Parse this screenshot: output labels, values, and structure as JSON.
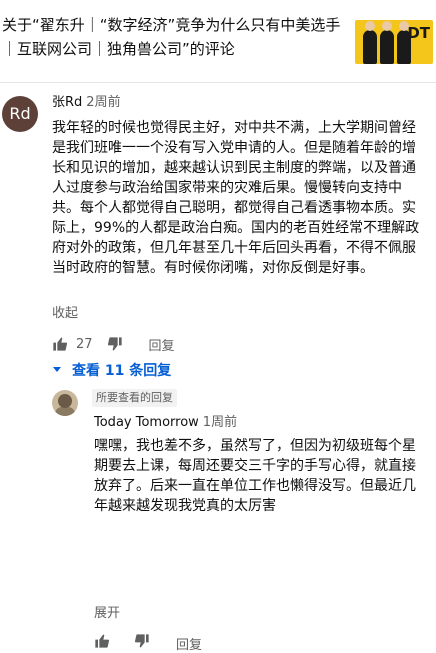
{
  "video": {
    "title": "关于“翟东升｜“数字经济”竞争为什么只有中美选手｜互联网公司｜独角兽公司”的评论",
    "thumbnail_logo": "DT"
  },
  "comment": {
    "avatar_initials": "Rd",
    "author": "张Rd",
    "time": "2周前",
    "text": "我年轻的时候也觉得民主好，对中共不满，上大学期间曾经是我们班唯一一个没有写入党申请的人。但是随着年龄的增长和见识的增加，越来越认识到民主制度的弊端，以及普通人过度参与政治给国家带来的灾难后果。慢慢转向支持中共。每个人都觉得自己聪明，都觉得自己看透事物本质。实际上，99%的人都是政治白痴。国内的老百姓经常不理解政府对外的政策，但几年甚至几十年后回头再看，不得不佩服当时政府的智慧。有时候你闭嘴，对你反倒是好事。",
    "collapse_label": "收起",
    "like_count": "27",
    "reply_label": "回复"
  },
  "replies_toggle": {
    "label": "查看 11 条回复"
  },
  "reply": {
    "badge": "所要查看的回复",
    "author": "Today Tomorrow",
    "time": "1周前",
    "text": "嘿嘿，我也差不多，虽然写了，但因为初级班每个星期要去上课，每周还要交三千字的手写心得，就直接放弃了。后来一直在单位工作也懒得没写。但最近几年越来越发现我党真的太厉害",
    "expand_label": "展开",
    "reply_label": "回复"
  },
  "colors": {
    "link": "#065fd4",
    "secondary": "#606060",
    "accent_yellow": "#f4c51b"
  }
}
